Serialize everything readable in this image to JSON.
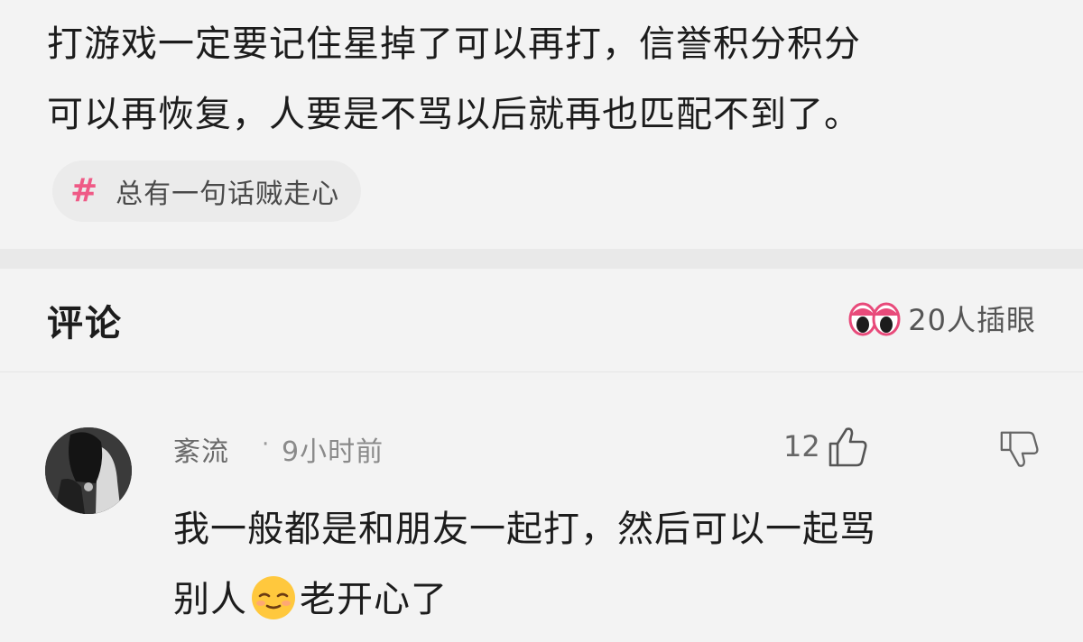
{
  "post": {
    "line1": "打游戏一定要记住星掉了可以再打，信誉积分积分",
    "line2": "可以再恢复，人要是不骂以后就再也匹配不到了。"
  },
  "topic_tag": {
    "label": "总有一句话贼走心"
  },
  "comments_section": {
    "heading": "评论",
    "watchers_label": "20人插眼"
  },
  "comment": {
    "username": "紊流",
    "separator": "·",
    "time": "9小时前",
    "like_count": "12",
    "body_line1": "我一般都是和朋友一起打，然后可以一起骂",
    "body_line2_before": "别人",
    "body_line2_after": "老开心了"
  },
  "colors": {
    "tag_hash": "#ef5a86",
    "background": "#f3f3f3"
  },
  "icons": {
    "tag": "hash-icon",
    "watchers": "eyes-icon",
    "like": "thumbs-up-icon",
    "dislike": "thumbs-down-icon",
    "emoji": "relieved-face-emoji"
  }
}
